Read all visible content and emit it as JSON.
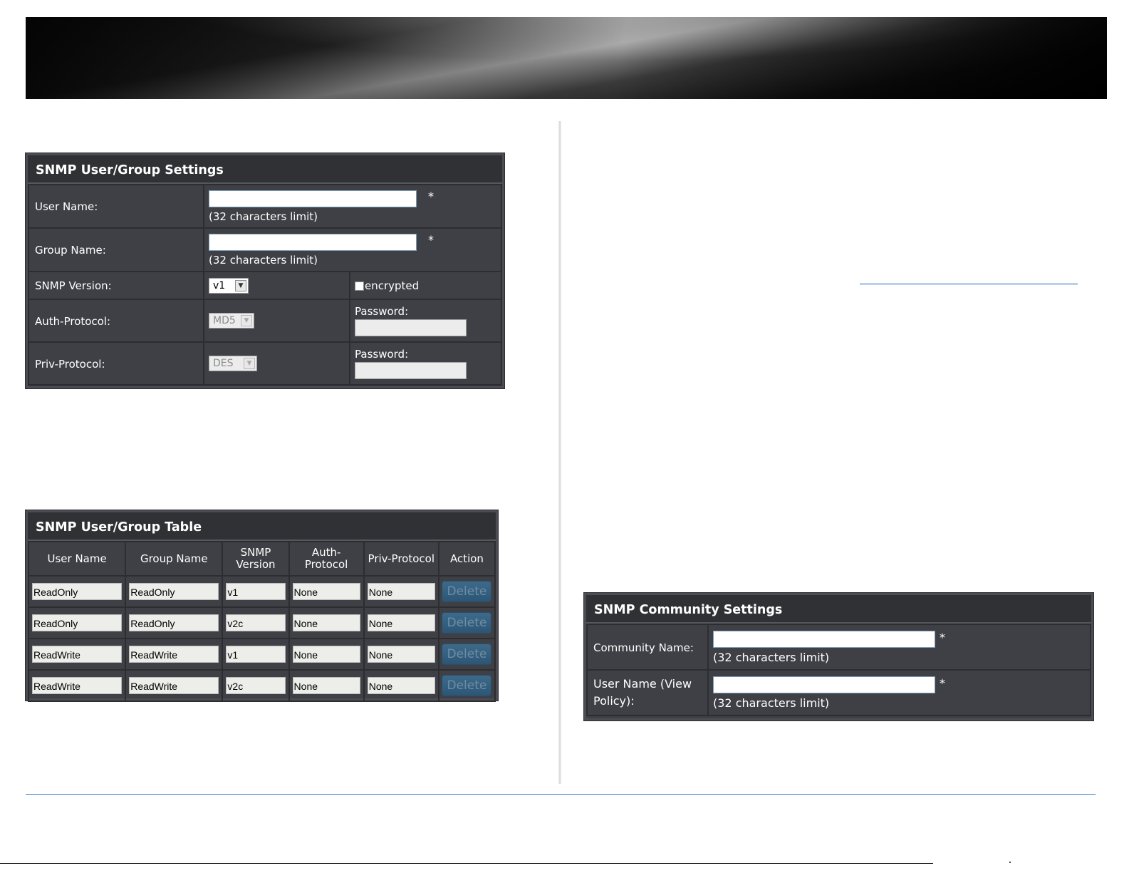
{
  "user_group_settings": {
    "title": "SNMP User/Group Settings",
    "user_name_label": "User Name:",
    "user_name_value": "",
    "group_name_label": "Group Name:",
    "group_name_value": "",
    "limit_note": "(32 characters limit)",
    "required_mark": "*",
    "snmp_version_label": "SNMP Version:",
    "snmp_version_value": "v1",
    "encrypted_label": "encrypted",
    "auth_protocol_label": "Auth-Protocol:",
    "auth_protocol_value": "MD5",
    "priv_protocol_label": "Priv-Protocol:",
    "priv_protocol_value": "DES",
    "password_label": "Password:"
  },
  "user_group_table": {
    "title": "SNMP User/Group Table",
    "headers": [
      "User Name",
      "Group Name",
      "SNMP Version",
      "Auth-Protocol",
      "Priv-Protocol",
      "Action"
    ],
    "header_lines": [
      [
        "User Name"
      ],
      [
        "Group Name"
      ],
      [
        "SNMP",
        "Version"
      ],
      [
        "Auth-",
        "Protocol"
      ],
      [
        "Priv-Protocol"
      ],
      [
        "Action"
      ]
    ],
    "rows": [
      {
        "user": "ReadOnly",
        "group": "ReadOnly",
        "version": "v1",
        "auth": "None",
        "priv": "None",
        "action": "Delete"
      },
      {
        "user": "ReadOnly",
        "group": "ReadOnly",
        "version": "v2c",
        "auth": "None",
        "priv": "None",
        "action": "Delete"
      },
      {
        "user": "ReadWrite",
        "group": "ReadWrite",
        "version": "v1",
        "auth": "None",
        "priv": "None",
        "action": "Delete"
      },
      {
        "user": "ReadWrite",
        "group": "ReadWrite",
        "version": "v2c",
        "auth": "None",
        "priv": "None",
        "action": "Delete"
      }
    ]
  },
  "community_settings": {
    "title": "SNMP Community Settings",
    "community_name_label": "Community Name:",
    "community_name_value": "",
    "view_policy_label_1": "User Name (View",
    "view_policy_label_2": "Policy):",
    "view_policy_value": "",
    "limit_note": "(32 characters limit)",
    "required_mark": "*"
  },
  "colors": {
    "panel_bg": "#3e4045",
    "panel_title_bg": "#2f3134",
    "delete_button": "#2d5675",
    "link_line": "#1a5fb4",
    "footer_line": "#4a86c5"
  }
}
